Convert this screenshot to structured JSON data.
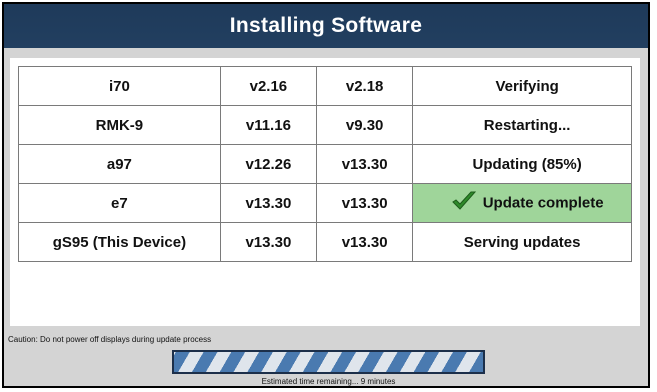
{
  "window": {
    "title": "Installing Software"
  },
  "devices": [
    {
      "name": "i70",
      "current_version": "v2.16",
      "new_version": "v2.18",
      "status": "Verifying",
      "complete": false
    },
    {
      "name": "RMK-9",
      "current_version": "v11.16",
      "new_version": "v9.30",
      "status": "Restarting...",
      "complete": false
    },
    {
      "name": "a97",
      "current_version": "v12.26",
      "new_version": "v13.30",
      "status": "Updating (85%)",
      "complete": false
    },
    {
      "name": "e7",
      "current_version": "v13.30",
      "new_version": "v13.30",
      "status": "Update complete",
      "complete": true,
      "icon": "check-icon"
    },
    {
      "name": "gS95 (This Device)",
      "current_version": "v13.30",
      "new_version": "v13.30",
      "status": "Serving updates",
      "complete": false
    }
  ],
  "footer": {
    "caution": "Caution: Do not power off displays during update process",
    "estimate": "Estimated time remaining... 9 minutes"
  },
  "colors": {
    "title_bar": "#223f60",
    "complete_highlight": "#9fd59a",
    "progress_stripe": "#4a7ab0",
    "check_mark": "#2e8a2a"
  }
}
